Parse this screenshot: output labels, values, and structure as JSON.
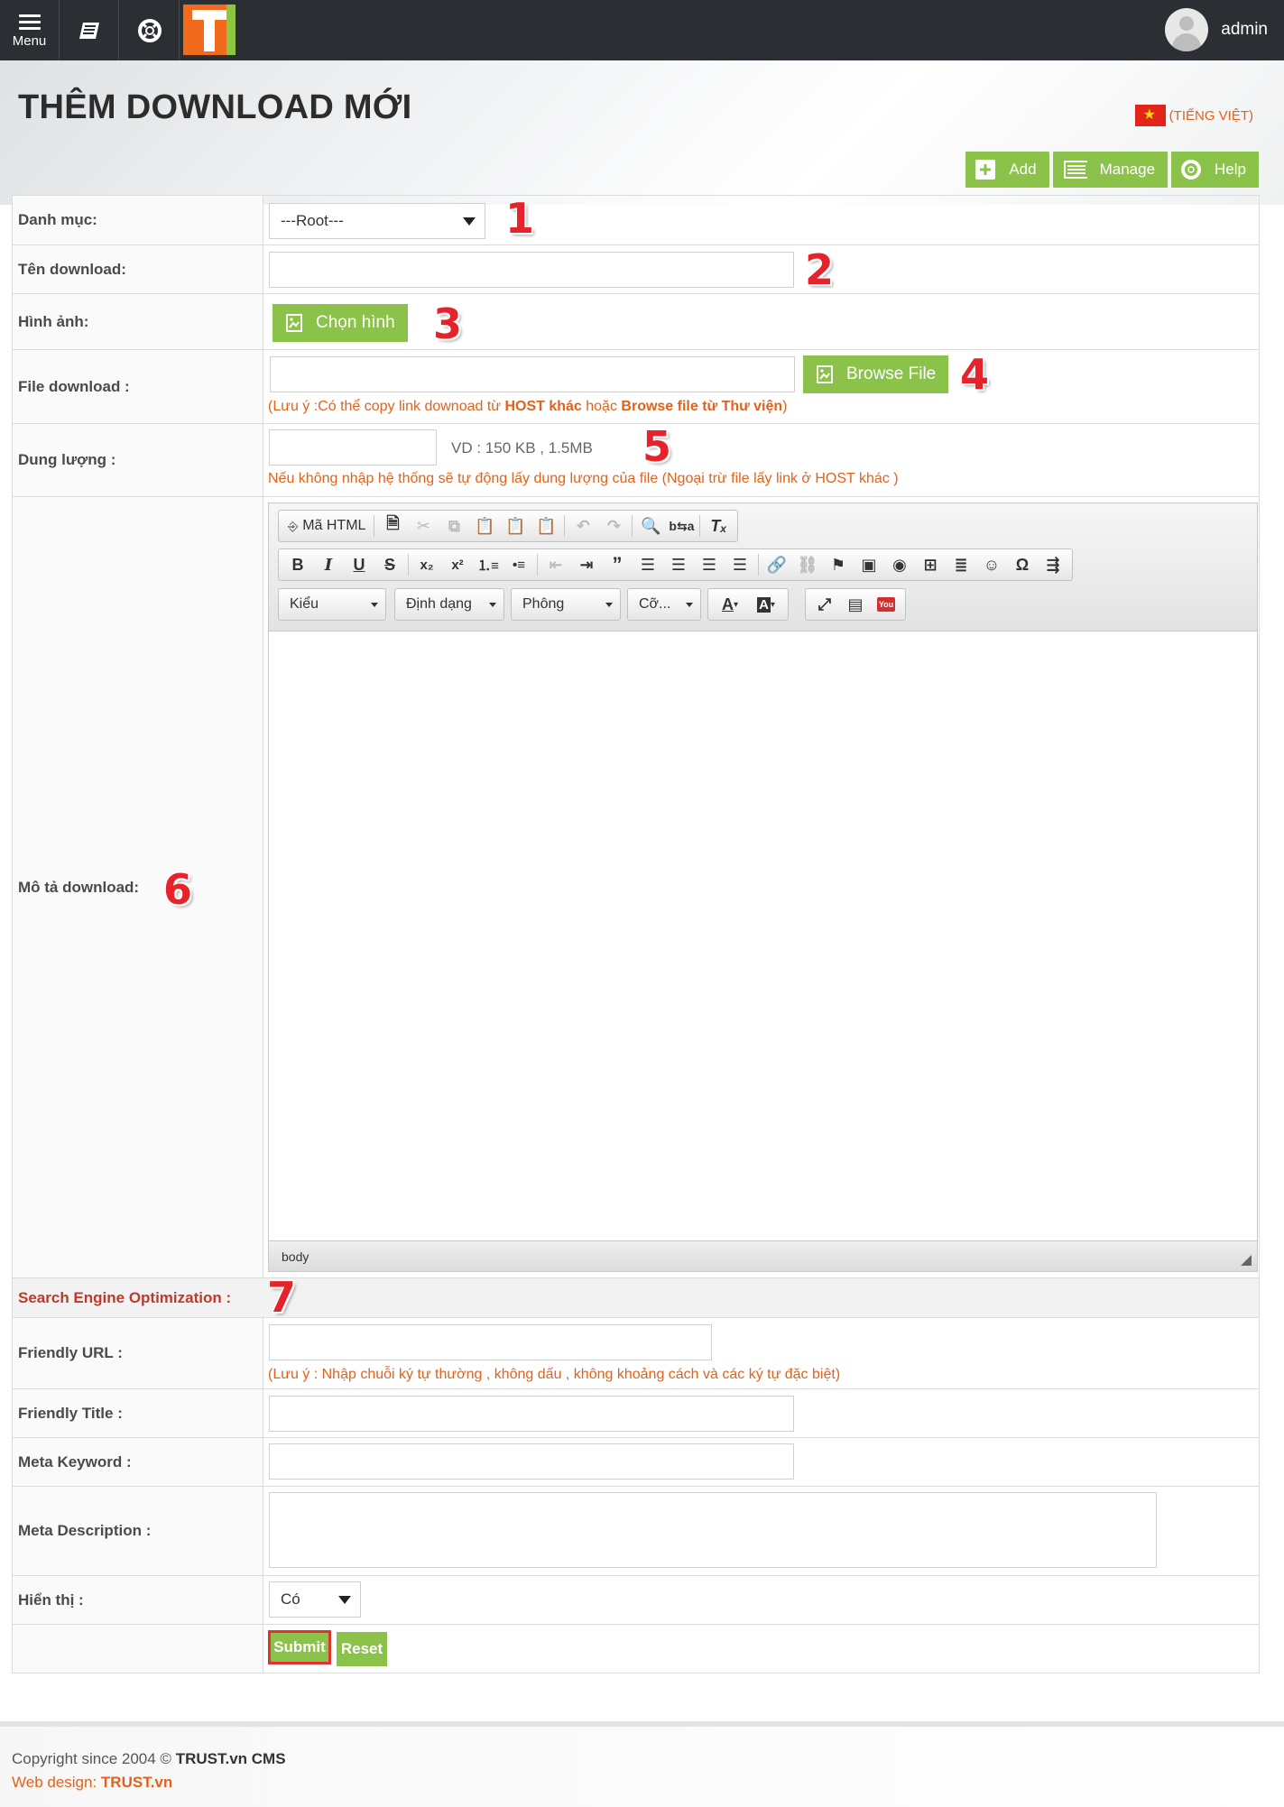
{
  "topbar": {
    "menu_label": "Menu",
    "user_name": "admin"
  },
  "page": {
    "title": "THÊM DOWNLOAD MỚI",
    "language": "(TIẾNG VIỆT)"
  },
  "actions": {
    "add": "Add",
    "manage": "Manage",
    "help": "Help"
  },
  "form": {
    "category": {
      "label": "Danh mục:",
      "value": "---Root---",
      "marker": "1"
    },
    "name": {
      "label": "Tên download:",
      "value": "",
      "marker": "2"
    },
    "image": {
      "label": "Hình ảnh:",
      "button": "Chọn hình",
      "marker": "3"
    },
    "file": {
      "label": "File download :",
      "button": "Browse File",
      "marker": "4",
      "note_prefix": "(Lưu ý :Có thể copy link downoad từ ",
      "note_bold1": "HOST khác",
      "note_mid": " hoặc ",
      "note_bold2": "Browse file từ Thư viện",
      "note_suffix": ")"
    },
    "size": {
      "label": "Dung lượng :",
      "example": "VD : 150 KB , 1.5MB",
      "marker": "5",
      "note": "Nếu không nhập hệ thống sẽ tự động lấy dung lượng của file (Ngoại trừ file lấy link ở HOST khác )"
    },
    "description": {
      "label": "Mô tả download:",
      "marker": "6",
      "editor": {
        "source_label": "Mã HTML",
        "style_combo": "Kiểu",
        "format_combo": "Định dạng",
        "font_combo": "Phông",
        "size_combo": "Cỡ...",
        "status_path": "body"
      }
    },
    "seo": {
      "label": "Search Engine Optimization :",
      "marker": "7"
    },
    "friendly_url": {
      "label": "Friendly URL :",
      "note": "(Lưu ý : Nhập chuỗi ký tự thường , không dấu , không khoảng cách và các ký tự đặc biệt)"
    },
    "friendly_title": {
      "label": "Friendly Title :"
    },
    "meta_keyword": {
      "label": "Meta Keyword :"
    },
    "meta_description": {
      "label": "Meta Description :"
    },
    "display": {
      "label": "Hiển thị :",
      "value": "Có"
    },
    "submit": "Submit",
    "reset": "Reset"
  },
  "footer": {
    "copyright_prefix": "Copyright since 2004 © ",
    "copyright_brand": "TRUST.vn CMS",
    "webdesign_prefix": "Web design: ",
    "webdesign_brand": "TRUST.vn"
  },
  "colors": {
    "accent_green": "#8bc34a",
    "note_orange": "#e2621b",
    "seo_red": "#c0392b",
    "marker_red": "#e8222a",
    "topbar_bg": "#2b2f33"
  }
}
